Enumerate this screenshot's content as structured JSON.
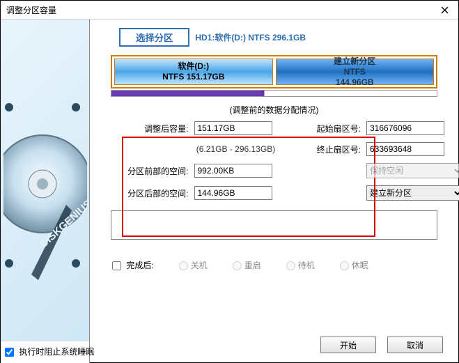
{
  "title": "调整分区容量",
  "select_partition_btn": "选择分区",
  "disk_label": "HD1:软件(D:) NTFS 296.1GB",
  "partA": {
    "name": "软件(D:)",
    "info": "NTFS 151.17GB"
  },
  "partB": {
    "name": "建立新分区",
    "fs": "NTFS",
    "size": "144.96GB"
  },
  "section_title": "(调整前的数据分配情况)",
  "labels": {
    "new_size": "调整后容量:",
    "range": "(6.21GB - 296.13GB)",
    "front_space": "分区前部的空间:",
    "back_space": "分区后部的空间:",
    "start_sector": "起始扇区号:",
    "end_sector": "终止扇区号:"
  },
  "values": {
    "new_size": "151.17GB",
    "front_space": "992.00KB",
    "back_space": "144.96GB",
    "start_sector": "316676096",
    "end_sector": "633693648"
  },
  "front_action_selected": "保持空闲",
  "back_action_selected": "建立新分区",
  "after_done": "完成后:",
  "radios": {
    "shutdown": "关机",
    "reboot": "重启",
    "standby": "待机",
    "hibernate": "休眠"
  },
  "prevent_sleep": "执行时阻止系统睡眠",
  "start_btn": "开始",
  "cancel_btn": "取消",
  "brand": "DISKGENIUS"
}
